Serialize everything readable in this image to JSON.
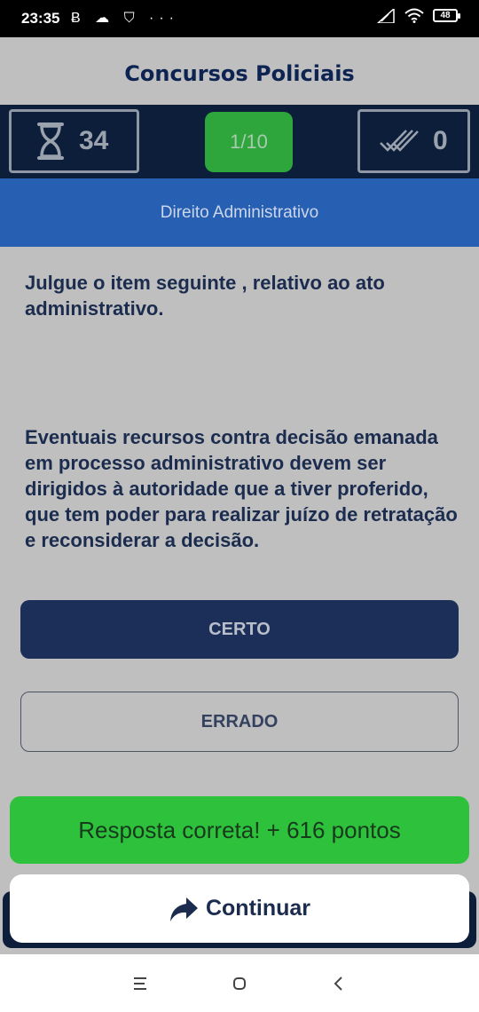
{
  "status_bar": {
    "time": "23:35",
    "notif_icons": "Ƀ ☁ ⛉ ···",
    "battery": "48"
  },
  "app": {
    "title": "Concursos Policiais",
    "timer_value": "34",
    "progress": "1/10",
    "correct_count": "0",
    "category": "Direito Administrativo",
    "question_intro": "Julgue o item seguinte , relativo ao ato administrativo.",
    "question_body": "Eventuais recursos contra decisão emanada em processo administrativo devem ser dirigidos à autoridade que a tiver proferido, que tem poder para realizar juízo de retratação e reconsiderar a decisão.",
    "answer_true": "CERTO",
    "answer_false": "ERRADO",
    "feedback": "Resposta correta! + 616 pontos",
    "continue": "Continuar"
  },
  "colors": {
    "navy": "#0d1e3b",
    "blue_band": "#275fb3",
    "green": "#2ec23c",
    "text_dark": "#1b2c4f"
  }
}
